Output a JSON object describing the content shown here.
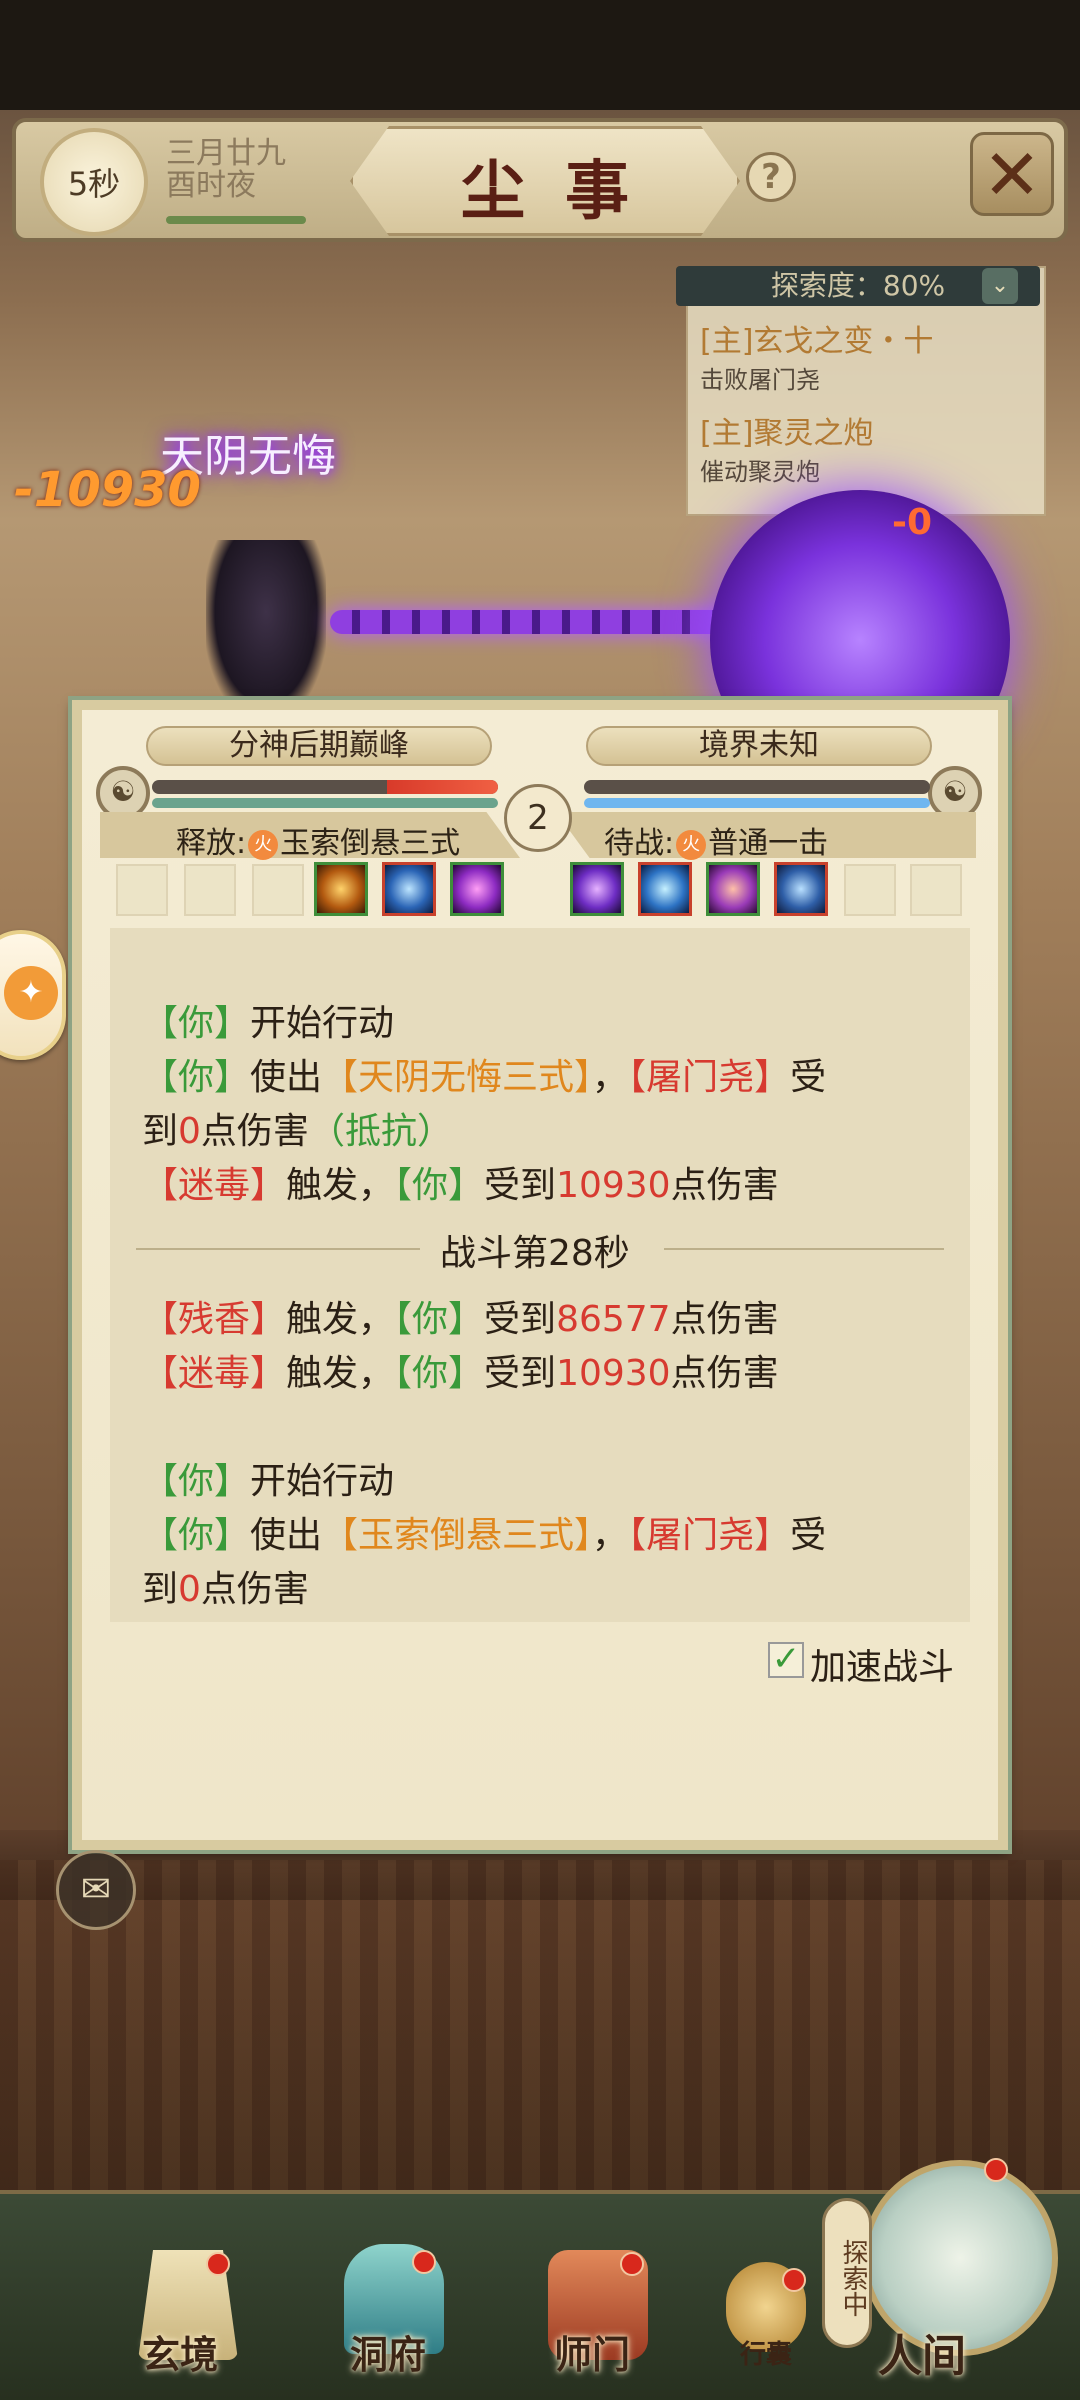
{
  "header": {
    "timer": "5秒",
    "date_line1": "三月廿九",
    "date_line2": "酉时夜",
    "title": "尘事",
    "help_icon": "question-icon",
    "close_icon": "crossed-swords-icon"
  },
  "quest": {
    "explore_label": "探索度：80%",
    "items": [
      {
        "title": "[主]玄戈之变・十",
        "desc": "击败屠门尧"
      },
      {
        "title": "[主]聚灵之炮",
        "desc": "催动聚灵炮"
      }
    ]
  },
  "battle_fx": {
    "skill_name": "天阴无悔",
    "damage_left": "-10930",
    "damage_right": "-0"
  },
  "battle": {
    "left_realm": "分神后期巅峰",
    "right_realm": "境界未知",
    "round": "2",
    "left_hp_percent": 32,
    "left_mp_percent": 100,
    "right_hp_percent": 0,
    "right_mp_percent": 100,
    "release_label": "释放:",
    "release_skill": "玉索倒悬三式",
    "wait_label": "待战:",
    "wait_skill": "普通一击",
    "element_glyph": "火"
  },
  "log": {
    "l1_you": "【你】",
    "l1_text": "开始行动",
    "l2_you": "【你】",
    "l2_use": "使出",
    "l2_skill": "【天阴无悔三式】",
    "l2_comma": "，",
    "l2_target": "【屠门尧】",
    "l2_recv": "受",
    "l3_to": "到",
    "l3_num": "0",
    "l3_text": "点伤害",
    "l3_resist": "（抵抗）",
    "l4_debuff": "【迷毒】",
    "l4_trigger": "触发，",
    "l4_you": "【你】",
    "l4_recv": "受到",
    "l4_num": "10930",
    "l4_text": "点伤害",
    "separator": "战斗第28秒",
    "l5_debuff": "【残香】",
    "l5_trigger": "触发，",
    "l5_you": "【你】",
    "l5_recv": "受到",
    "l5_num": "86577",
    "l5_text": "点伤害",
    "l6_debuff": "【迷毒】",
    "l6_trigger": "触发，",
    "l6_you": "【你】",
    "l6_recv": "受到",
    "l6_num": "10930",
    "l6_text": "点伤害",
    "l7_you": "【你】",
    "l7_text": "开始行动",
    "l8_you": "【你】",
    "l8_use": "使出",
    "l8_skill": "【玉索倒悬三式】",
    "l8_comma": "，",
    "l8_target": "【屠门尧】",
    "l8_recv": "受",
    "l9_to": "到",
    "l9_num": "0",
    "l9_text": "点伤害"
  },
  "accelerate": {
    "label": "加速战斗",
    "checked": true
  },
  "nav": {
    "items": [
      "玄境",
      "洞府",
      "师门",
      "行囊",
      "人间"
    ],
    "explore_badge": "探索中"
  },
  "colors": {
    "you": "#3a9a3a",
    "skill": "#e0871d",
    "enemy": "#d73a30",
    "damage_number": "#d73a30"
  }
}
